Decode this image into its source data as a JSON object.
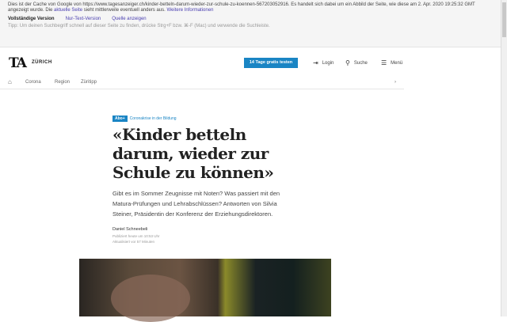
{
  "cache_banner": {
    "line1": "Dies ist der Cache von Google von https://www.tagesanzeiger.ch/kinder-betteln-darum-wieder-zur-schule-zu-koennen-567203052916. Es handelt sich dabei um ein Abbild der Seite, wie diese am 2. Apr. 2020 19:25:32 GMT angezeigt wurde. Die",
    "current_page_link": "aktuelle Seite",
    "line1_end": "sieht mittlerweile eventuell anders",
    "line2_prefix": "aus.",
    "more_info_link": "Weitere Informationen",
    "full_version": "Vollständige Version",
    "text_version": "Nur-Text-Version",
    "view_source": "Quelle anzeigen",
    "tip": "Tipp: Um deinen Suchbegriff schnell auf dieser Seite zu finden, drücke Strg+F bzw. ⌘-F (Mac) und verwende die Suchleiste."
  },
  "header": {
    "logo": "TA",
    "city": "ZÜRICH",
    "cta": "14 Tage gratis testen",
    "login": "Login",
    "search": "Suche",
    "menu": "Menü"
  },
  "nav": {
    "items": [
      "Corona",
      "Region",
      "Züritipp"
    ],
    "next": "›"
  },
  "article": {
    "badge": "Abo+",
    "kicker": "Coronakrise in der Bildung",
    "title": "«Kinder betteln darum, wieder zur Schule zu können»",
    "lead": "Gibt es im Sommer Zeugnisse mit Noten? Was passiert mit den Matura-Prüfungen und Lehrabschlüssen? Antworten von Silvia Steiner, Präsidentin der Konferenz der Erziehungsdirektoren.",
    "author": "Daniel Schneebeli",
    "published": "Publiziert heute um 10:53 Uhr",
    "updated": "Aktualisiert vor 57 Minuten"
  }
}
